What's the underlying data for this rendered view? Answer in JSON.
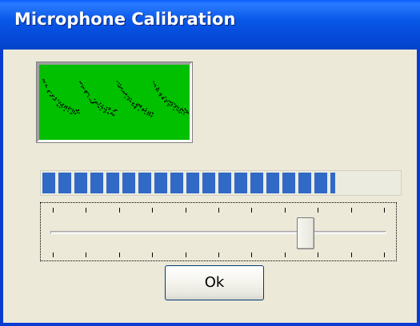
{
  "window": {
    "title": "Microphone Calibration",
    "titlebar_color": "#0a58e8"
  },
  "waveform": {
    "background_color": "#00c000",
    "trace_color": "#000000"
  },
  "level_meter": {
    "level_fraction": 0.82,
    "segment_color": "#3169c6"
  },
  "sensitivity_slider": {
    "value_fraction": 0.76,
    "tick_count": 11
  },
  "buttons": {
    "ok_label": "Ok"
  }
}
